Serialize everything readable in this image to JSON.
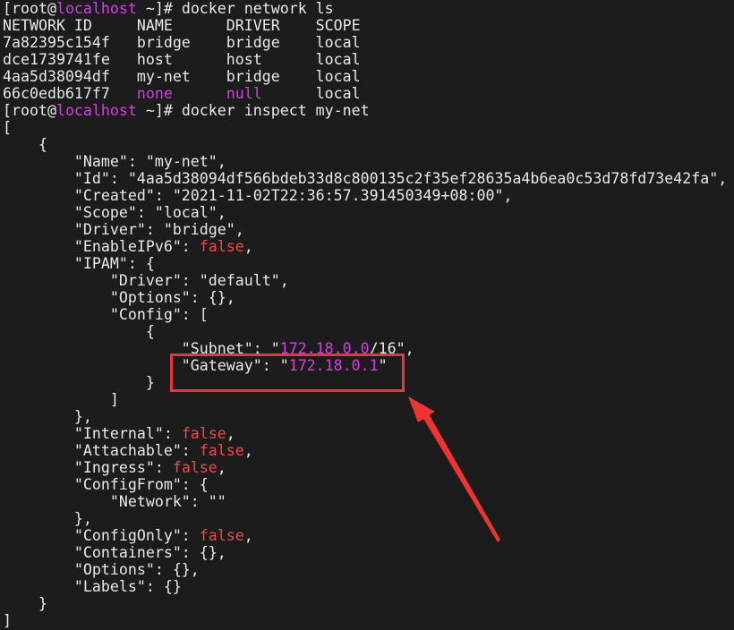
{
  "colors": {
    "background": "#1c1c1c",
    "text": "#e8e8e8",
    "magenta": "#d63ce6",
    "red": "#f04848",
    "annotation": "#ee3333"
  },
  "terminal": {
    "lines": [
      [
        {
          "t": "[root@",
          "c": "w"
        },
        {
          "t": "localhost",
          "c": "m"
        },
        {
          "t": " ~]# docker network ls",
          "c": "w"
        }
      ],
      [
        {
          "t": "NETWORK ID     NAME      DRIVER    SCOPE",
          "c": "w"
        }
      ],
      [
        {
          "t": "7a82395c154f   bridge    bridge    local",
          "c": "w"
        }
      ],
      [
        {
          "t": "dce1739741fe   host      host      local",
          "c": "w"
        }
      ],
      [
        {
          "t": "4aa5d38094df   my-net    bridge    local",
          "c": "w"
        }
      ],
      [
        {
          "t": "66c0edb617f7   ",
          "c": "w"
        },
        {
          "t": "none",
          "c": "m"
        },
        {
          "t": "      ",
          "c": "w"
        },
        {
          "t": "null",
          "c": "m"
        },
        {
          "t": "      local",
          "c": "w"
        }
      ],
      [
        {
          "t": "[root@",
          "c": "w"
        },
        {
          "t": "localhost",
          "c": "m"
        },
        {
          "t": " ~]# docker inspect my-net",
          "c": "w"
        }
      ],
      [
        {
          "t": "[",
          "c": "w"
        }
      ],
      [
        {
          "t": "    {",
          "c": "w"
        }
      ],
      [
        {
          "t": "        \"Name\": \"my-net\",",
          "c": "w"
        }
      ],
      [
        {
          "t": "        \"Id\": \"4aa5d38094df566bdeb33d8c800135c2f35ef28635a4b6ea0c53d78fd73e42fa\",",
          "c": "w"
        }
      ],
      [
        {
          "t": "        \"Created\": \"2021-11-02T22:36:57.391450349+08:00\",",
          "c": "w"
        }
      ],
      [
        {
          "t": "        \"Scope\": \"local\",",
          "c": "w"
        }
      ],
      [
        {
          "t": "        \"Driver\": \"bridge\",",
          "c": "w"
        }
      ],
      [
        {
          "t": "        \"EnableIPv6\": ",
          "c": "w"
        },
        {
          "t": "false",
          "c": "r"
        },
        {
          "t": ",",
          "c": "w"
        }
      ],
      [
        {
          "t": "        \"IPAM\": {",
          "c": "w"
        }
      ],
      [
        {
          "t": "            \"Driver\": \"default\",",
          "c": "w"
        }
      ],
      [
        {
          "t": "            \"Options\": {},",
          "c": "w"
        }
      ],
      [
        {
          "t": "            \"Config\": [",
          "c": "w"
        }
      ],
      [
        {
          "t": "                {",
          "c": "w"
        }
      ],
      [
        {
          "t": "                    \"Subnet\": \"",
          "c": "w"
        },
        {
          "t": "172.18.0.0",
          "c": "m"
        },
        {
          "t": "/16\",",
          "c": "w"
        }
      ],
      [
        {
          "t": "                    \"Gateway\": \"",
          "c": "w"
        },
        {
          "t": "172.18.0.1",
          "c": "m"
        },
        {
          "t": "\"",
          "c": "w"
        }
      ],
      [
        {
          "t": "                }",
          "c": "w"
        }
      ],
      [
        {
          "t": "            ]",
          "c": "w"
        }
      ],
      [
        {
          "t": "        },",
          "c": "w"
        }
      ],
      [
        {
          "t": "        \"Internal\": ",
          "c": "w"
        },
        {
          "t": "false",
          "c": "r"
        },
        {
          "t": ",",
          "c": "w"
        }
      ],
      [
        {
          "t": "        \"Attachable\": ",
          "c": "w"
        },
        {
          "t": "false",
          "c": "r"
        },
        {
          "t": ",",
          "c": "w"
        }
      ],
      [
        {
          "t": "        \"Ingress\": ",
          "c": "w"
        },
        {
          "t": "false",
          "c": "r"
        },
        {
          "t": ",",
          "c": "w"
        }
      ],
      [
        {
          "t": "        \"ConfigFrom\": {",
          "c": "w"
        }
      ],
      [
        {
          "t": "            \"Network\": \"\"",
          "c": "w"
        }
      ],
      [
        {
          "t": "        },",
          "c": "w"
        }
      ],
      [
        {
          "t": "        \"ConfigOnly\": ",
          "c": "w"
        },
        {
          "t": "false",
          "c": "r"
        },
        {
          "t": ",",
          "c": "w"
        }
      ],
      [
        {
          "t": "        \"Containers\": {},",
          "c": "w"
        }
      ],
      [
        {
          "t": "        \"Options\": {},",
          "c": "w"
        }
      ],
      [
        {
          "t": "        \"Labels\": {}",
          "c": "w"
        }
      ],
      [
        {
          "t": "    }",
          "c": "w"
        }
      ],
      [
        {
          "t": "]",
          "c": "w"
        }
      ]
    ]
  },
  "annotation": {
    "highlight": "gateway-line",
    "arrow_icon": "arrow-up-left-icon"
  }
}
